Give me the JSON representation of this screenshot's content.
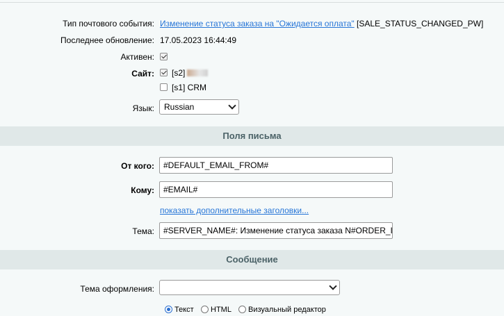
{
  "fields": {
    "event_type_label": "Тип почтового события:",
    "event_type_link": "Изменение статуса заказа на \"Ожидается оплата\"",
    "event_type_code": "[SALE_STATUS_CHANGED_PW]",
    "updated_label": "Последнее обновление:",
    "updated_value": "17.05.2023 16:44:49",
    "active_label": "Активен:",
    "active_checked": true,
    "site_label": "Сайт:",
    "sites": [
      {
        "label": "[s2]",
        "checked": true
      },
      {
        "label": "[s1] CRM",
        "checked": false
      }
    ],
    "language_label": "Язык:",
    "language_value": "Russian"
  },
  "section_fields": {
    "title": "Поля письма"
  },
  "mail": {
    "from_label": "От кого:",
    "from_value": "#DEFAULT_EMAIL_FROM#",
    "to_label": "Кому:",
    "to_value": "#EMAIL#",
    "show_headers_link": "показать дополнительные заголовки...",
    "subject_label": "Тема:",
    "subject_value": "#SERVER_NAME#: Изменение статуса заказа N#ORDER_ID#"
  },
  "section_message": {
    "title": "Сообщение"
  },
  "message": {
    "theme_label": "Тема оформления:",
    "theme_value": "",
    "format_options": [
      {
        "label": "Текст",
        "checked": true
      },
      {
        "label": "HTML",
        "checked": false
      },
      {
        "label": "Визуальный редактор",
        "checked": false
      }
    ]
  }
}
